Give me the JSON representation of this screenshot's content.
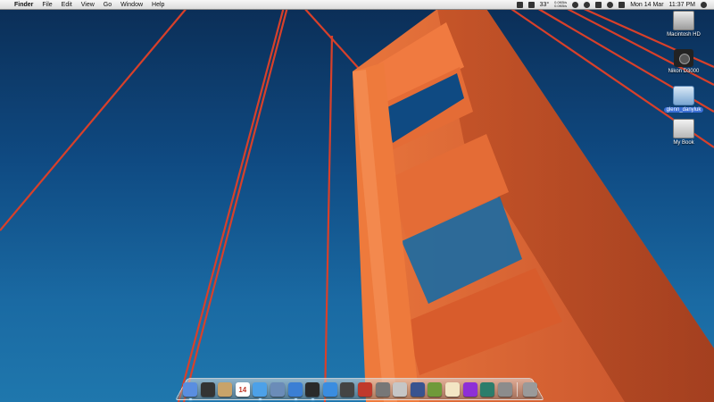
{
  "menubar": {
    "apple_glyph": "",
    "app_name": "Finder",
    "menus": [
      "File",
      "Edit",
      "View",
      "Go",
      "Window",
      "Help"
    ],
    "status": {
      "temperature": "33°",
      "net_up": "0.0KB/s",
      "net_down": "0.0KB/s",
      "datetime_date": "Mon 14 Mar",
      "datetime_time": "11:37 PM"
    },
    "status_icons": [
      "dropbox-icon",
      "cpu-icon",
      "network-speed",
      "time-machine-icon",
      "sync-icon",
      "battery-icon",
      "wifi-icon",
      "volume-icon",
      "spotlight-icon"
    ]
  },
  "desktop": {
    "icons": [
      {
        "label": "Macintosh HD",
        "kind": "hard-drive"
      },
      {
        "label": "Nikon D3000",
        "kind": "camera"
      },
      {
        "label": "glenn_danyluk",
        "kind": "network-drive",
        "selected": true
      },
      {
        "label": "My Book",
        "kind": "external-drive"
      }
    ]
  },
  "dock": {
    "items": [
      {
        "name": "finder",
        "color": "#5a8ee0"
      },
      {
        "name": "dashboard",
        "color": "#333333"
      },
      {
        "name": "contacts",
        "color": "#c8a36a"
      },
      {
        "name": "calendar",
        "color": "#ffffff",
        "text": "14"
      },
      {
        "name": "safari",
        "color": "#4da1e8"
      },
      {
        "name": "preview",
        "color": "#6b8cb8"
      },
      {
        "name": "itunes",
        "color": "#3b7fd4"
      },
      {
        "name": "aperture",
        "color": "#2a2a2a"
      },
      {
        "name": "app-store",
        "color": "#3a8de0"
      },
      {
        "name": "photo-browser",
        "color": "#444444"
      },
      {
        "name": "photo-booth",
        "color": "#c0392b"
      },
      {
        "name": "utility",
        "color": "#777777"
      },
      {
        "name": "image-capture",
        "color": "#c6c6c6"
      },
      {
        "name": "pen-tool",
        "color": "#39538f"
      },
      {
        "name": "tools-app",
        "color": "#6f9a3a"
      },
      {
        "name": "textedit",
        "color": "#f3e6c4"
      },
      {
        "name": "front-row",
        "color": "#8e2fd6"
      },
      {
        "name": "time-machine",
        "color": "#2c7d6b"
      },
      {
        "name": "system-preferences",
        "color": "#8c8c8c"
      },
      {
        "name": "trash",
        "color": "#9a9a9a"
      }
    ]
  }
}
